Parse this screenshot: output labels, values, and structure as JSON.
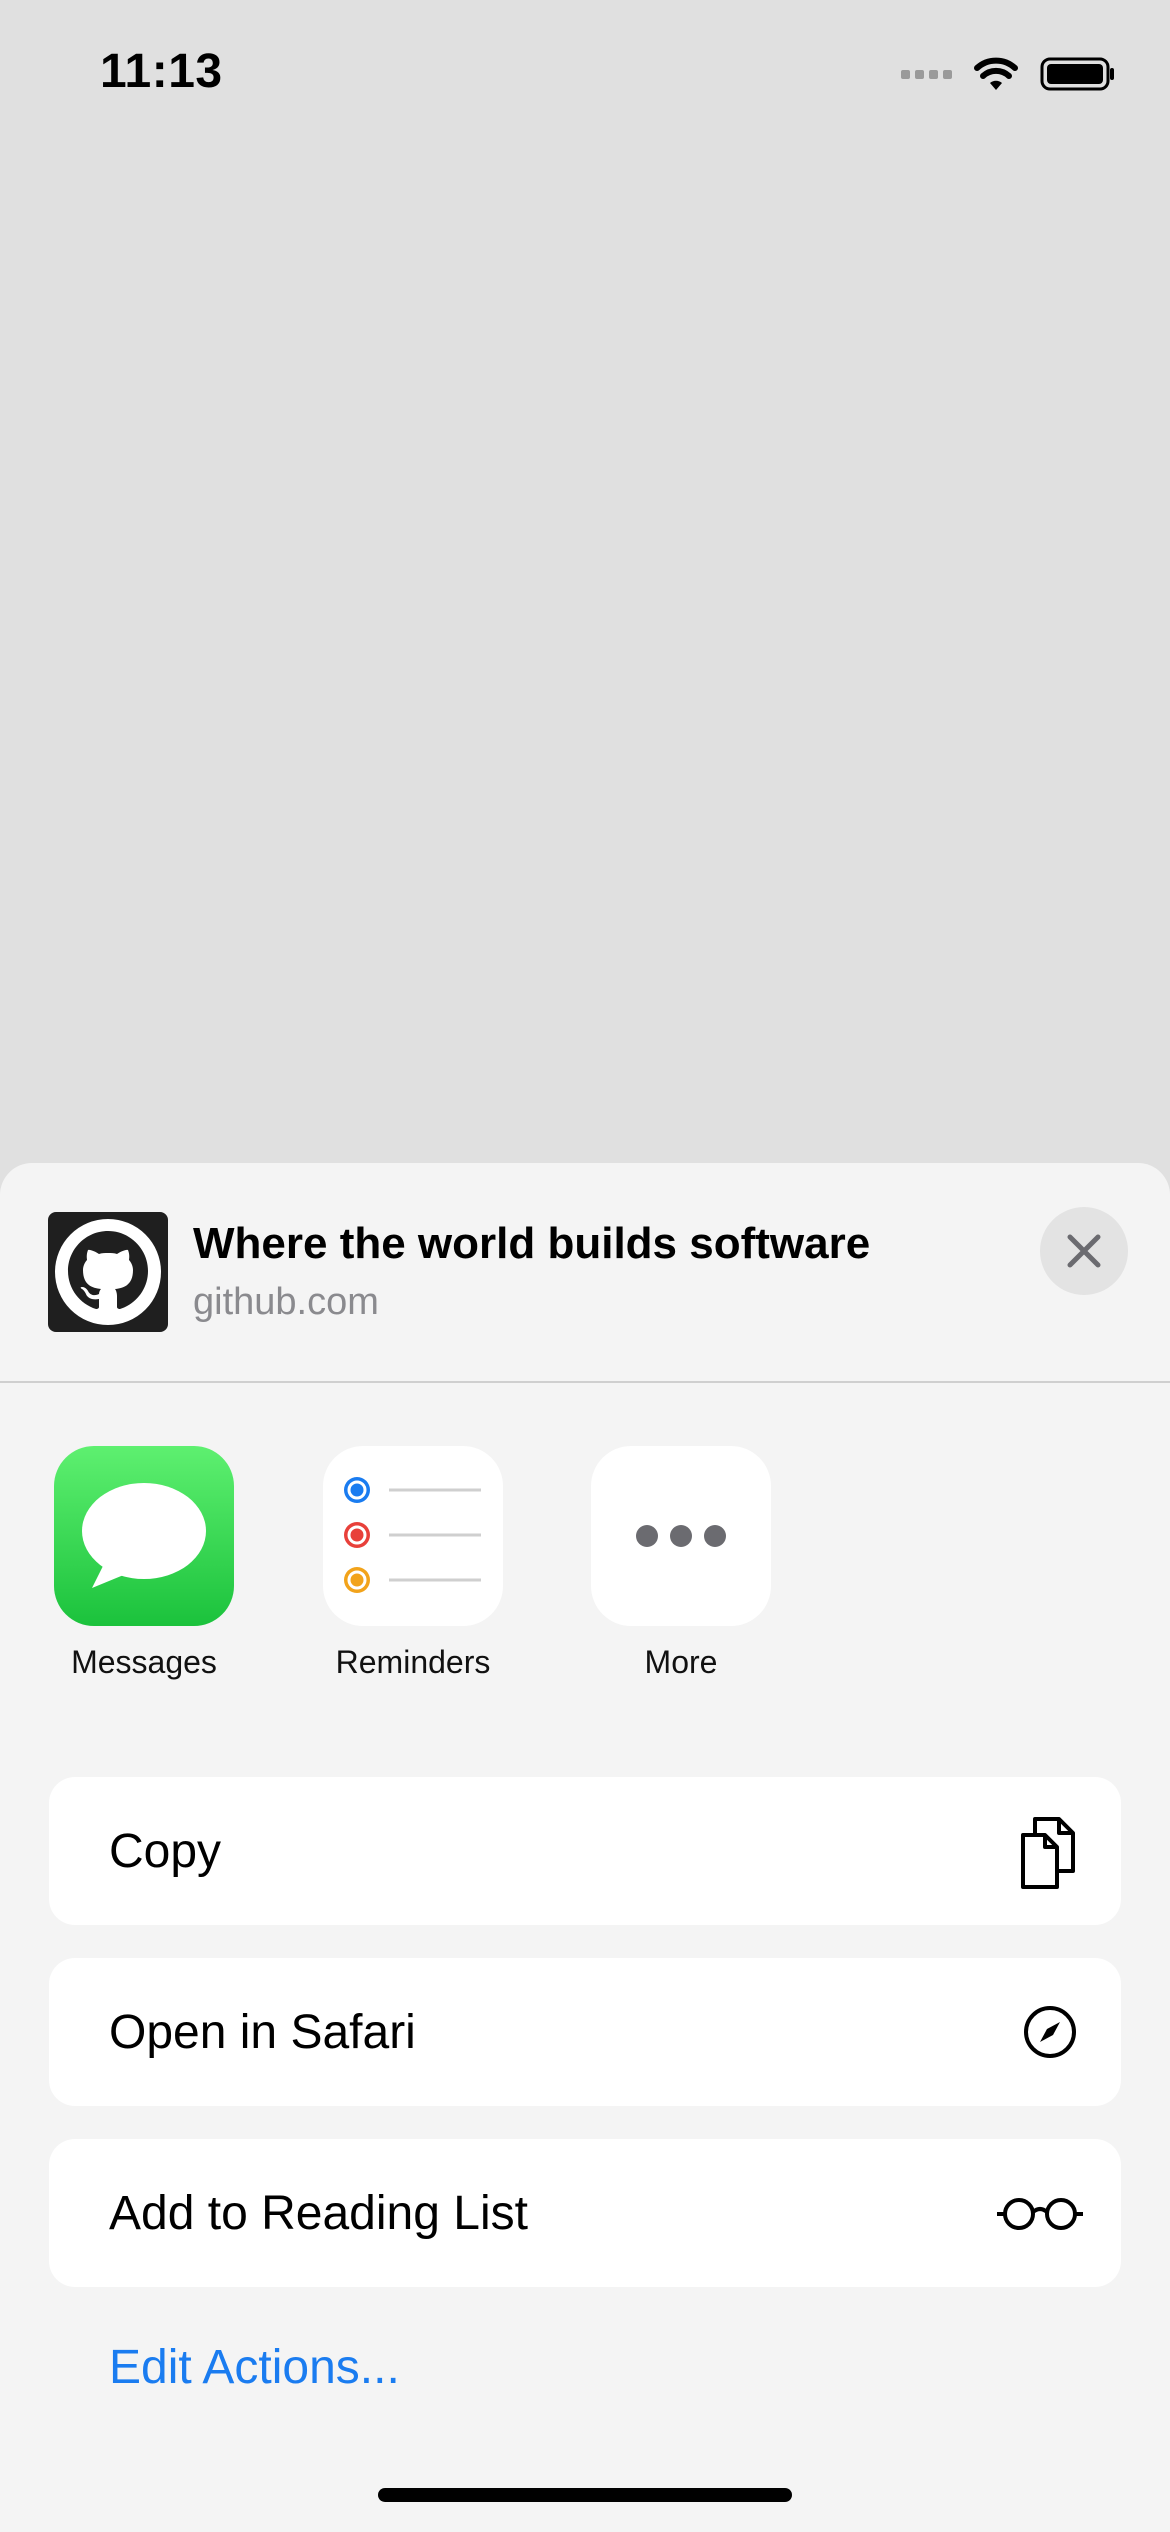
{
  "status_bar": {
    "time": "11:13"
  },
  "share_sheet": {
    "title": "Where the world builds software",
    "subtitle": "github.com",
    "site_icon": "github-icon",
    "close_icon": "close-icon"
  },
  "apps": [
    {
      "label": "Messages",
      "icon": "messages-icon"
    },
    {
      "label": "Reminders",
      "icon": "reminders-icon"
    },
    {
      "label": "More",
      "icon": "more-icon"
    }
  ],
  "actions": [
    {
      "label": "Copy",
      "icon": "copy-icon"
    },
    {
      "label": "Open in Safari",
      "icon": "compass-icon"
    },
    {
      "label": "Add to Reading List",
      "icon": "glasses-icon"
    }
  ],
  "edit_actions_label": "Edit Actions...",
  "colors": {
    "accent": "#1a7cf0",
    "messages_green": "#2ecc4f",
    "reminder_blue": "#1a7cf0",
    "reminder_red": "#e8403a",
    "reminder_orange": "#f2a31b"
  }
}
